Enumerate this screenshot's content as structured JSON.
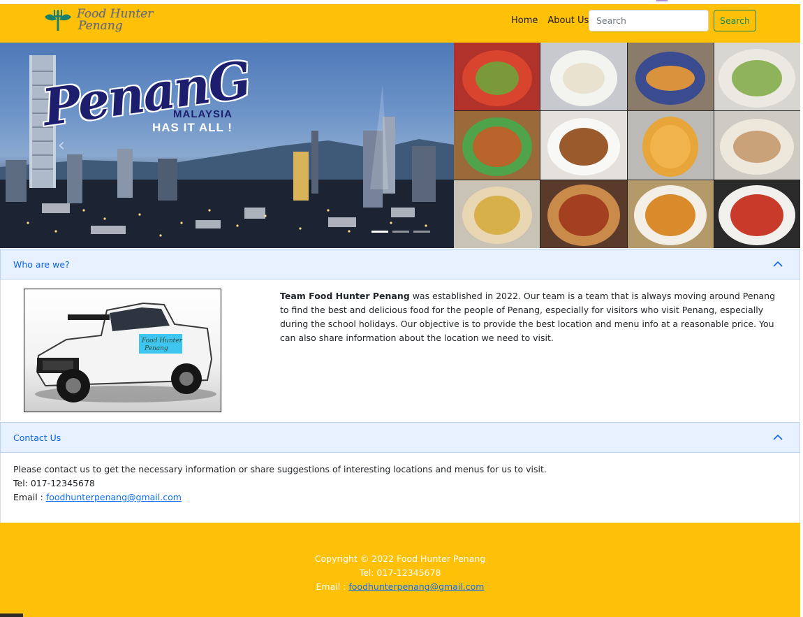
{
  "navbar": {
    "brand_line1": "Food Hunter",
    "brand_line2": "Penang",
    "links": [
      "Home",
      "About Us"
    ],
    "search_placeholder": "Search",
    "search_button": "Search"
  },
  "carousel": {
    "hero_word": "PenanG",
    "hero_sub": "MALAYSIA",
    "hero_tag": "HAS IT ALL !",
    "prev_glyph": "‹"
  },
  "about": {
    "title": "Who are we?",
    "team_name": "Team Food Hunter Penang",
    "text": " was established in 2022. Our team is a team that is always moving around Penang to find the best and delicious food for the people of Penang, especially for visitors who visit Penang, especially during the school holidays. Our objective is to provide the best location and menu info at a reasonable price. You can also share information about the location we need to visit.",
    "truck_decal": "Food Hunter Penang"
  },
  "contact": {
    "title": "Contact Us",
    "line1": "Please contact us to get the necessary information or share suggestions of interesting locations and menus for us to visit.",
    "tel": "Tel: 017-12345678",
    "email_label": "Email : ",
    "email": "foodhunterpenang@gmail.com"
  },
  "footer": {
    "copyright": "Copyright © 2022 Food Hunter Penang",
    "tel": "Tel: 017-12345678",
    "email_label": "Email : ",
    "email": "foodhunterpenang@gmail.com"
  },
  "colors": {
    "navbar": "#ffc107",
    "accordion_header": "#e7f1ff",
    "accordion_title": "#0c63e4",
    "search_button": "#198754",
    "link": "#0d6efd"
  }
}
